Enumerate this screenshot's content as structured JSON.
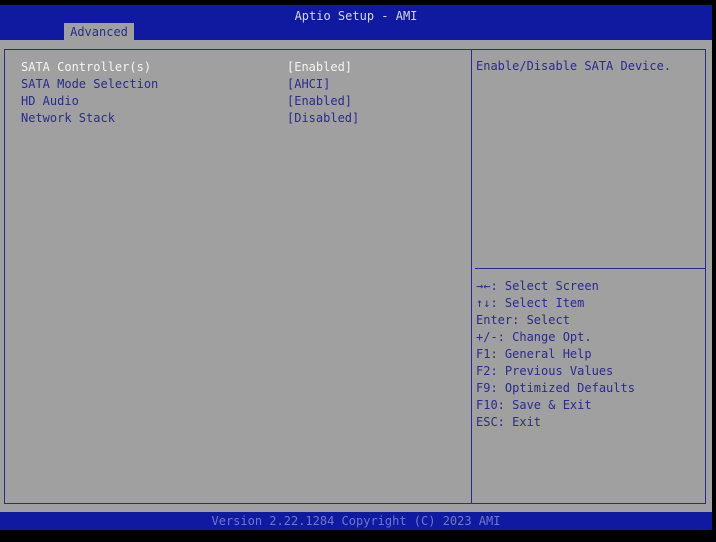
{
  "header": {
    "title": "Aptio Setup - AMI",
    "tabs": [
      {
        "label": "Advanced",
        "active": true
      }
    ]
  },
  "settings": [
    {
      "label": "SATA Controller(s)",
      "value": "[Enabled]",
      "selected": true
    },
    {
      "label": "SATA Mode Selection",
      "value": "[AHCI]",
      "selected": false
    },
    {
      "label": "HD Audio",
      "value": "[Enabled]",
      "selected": false
    },
    {
      "label": "Network Stack",
      "value": "[Disabled]",
      "selected": false
    }
  ],
  "help": {
    "text": "Enable/Disable SATA Device."
  },
  "keys": [
    "→←: Select Screen",
    "↑↓: Select Item",
    "Enter: Select",
    "+/-: Change Opt.",
    "F1: General Help",
    "F2: Previous Values",
    "F9: Optimized Defaults",
    "F10: Save & Exit",
    "ESC: Exit"
  ],
  "footer": {
    "text": "Version 2.22.1284 Copyright (C) 2023 AMI"
  },
  "colors": {
    "header_bg": "#0f1aa0",
    "body_bg": "#a0a0a0",
    "text": "#2a2a90",
    "selected": "#f4f4f4"
  }
}
